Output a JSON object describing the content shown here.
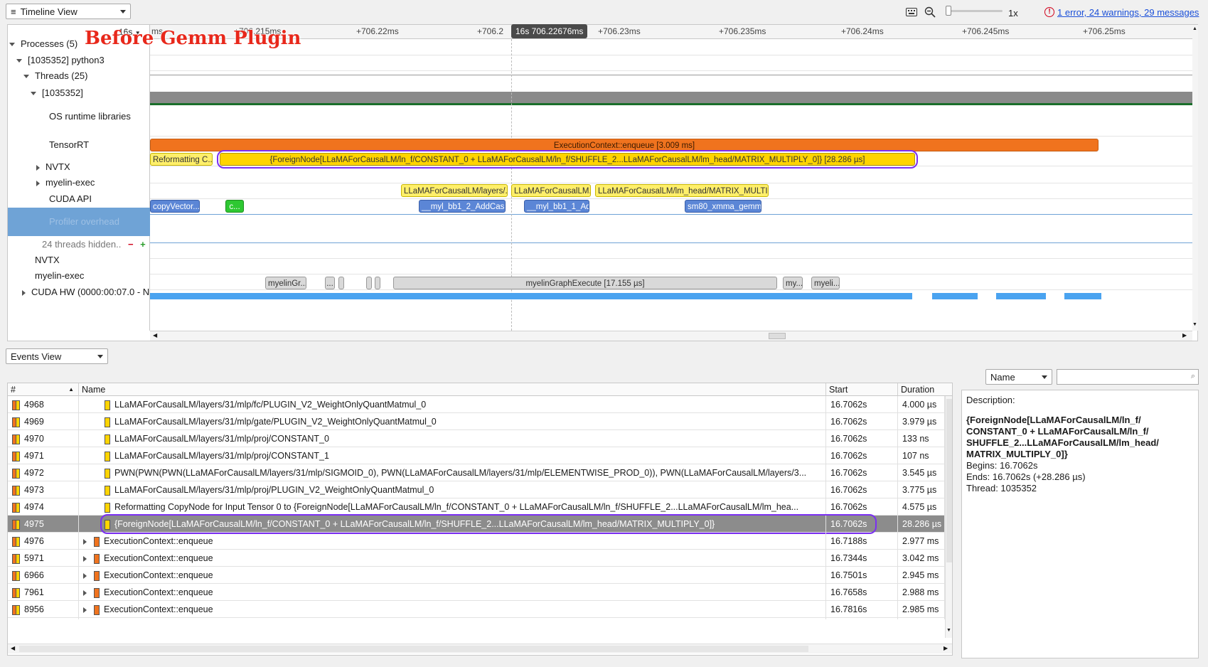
{
  "toolbar": {
    "view_label": "Timeline View",
    "zoom_label": "1x",
    "messages_link": "1 error, 24 warnings, 29 messages"
  },
  "overlay_title": "Before Gemm Plugin",
  "ruler": {
    "start_label": "16s",
    "ticks": [
      "+706.215ms",
      "+706.22ms",
      "+706.2",
      "+706.23ms",
      "+706.235ms",
      "+706.24ms",
      "+706.245ms",
      "+706.25ms"
    ],
    "left_fragment": "ms",
    "cursor_label": "16s 706.22676ms"
  },
  "tree": {
    "processes": "Processes (5)",
    "process": "[1035352] python3",
    "threads": "Threads (25)",
    "thread": "[1035352]",
    "os_runtime": "OS runtime libraries",
    "tensorrt": "TensorRT",
    "nvtx": "NVTX",
    "myelin_exec": "myelin-exec",
    "cuda_api": "CUDA API",
    "profiler_overhead": "Profiler overhead",
    "threads_hidden": "24 threads hidden..",
    "nvtx2": "NVTX",
    "myelin_exec2": "myelin-exec",
    "cuda_hw": "CUDA HW (0000:00:07.0 - N"
  },
  "tracks": {
    "enqueue": "ExecutionContext::enqueue [3.009 ms]",
    "reformatting": "Reformatting C...",
    "foreign_node": "{ForeignNode[LLaMAForCausalLM/ln_f/CONSTANT_0 + LLaMAForCausalLM/ln_f/SHUFFLE_2...LLaMAForCausalLM/lm_head/MATRIX_MULTIPLY_0]} [28.286 µs]",
    "myelin_a": "LLaMAForCausalLM/layers/...",
    "myelin_b": "LLaMAForCausalLM...",
    "myelin_c": "LLaMAForCausalLM/lm_head/MATRIX_MULTIP...",
    "cuda_copy": "copyVector...",
    "cuda_c": "c...",
    "cuda_add1": "__myl_bb1_2_AddCas...",
    "cuda_add2": "__myl_bb1_1_Ad...",
    "cuda_gemm": "sm80_xmma_gemm...",
    "myelin_gr": "myelinGr...",
    "myelin_dots": "...",
    "myelin_exec_big": "myelinGraphExecute [17.155 µs]",
    "myelin_my": "my...",
    "myelin_myeli": "myeli..."
  },
  "events_view": {
    "view_label": "Events View",
    "filter_label": "Name",
    "search_placeholder": "",
    "columns": [
      "#",
      "Name",
      "Start",
      "Duration"
    ],
    "rows": [
      {
        "id": "4968",
        "name": "LLaMAForCausalLM/layers/31/mlp/fc/PLUGIN_V2_WeightOnlyQuantMatmul_0",
        "start": "16.7062s",
        "duration": "4.000 µs",
        "marker": "y",
        "expand": false,
        "indent": 2
      },
      {
        "id": "4969",
        "name": "LLaMAForCausalLM/layers/31/mlp/gate/PLUGIN_V2_WeightOnlyQuantMatmul_0",
        "start": "16.7062s",
        "duration": "3.979 µs",
        "marker": "y",
        "expand": false,
        "indent": 2
      },
      {
        "id": "4970",
        "name": "LLaMAForCausalLM/layers/31/mlp/proj/CONSTANT_0",
        "start": "16.7062s",
        "duration": "133 ns",
        "marker": "y",
        "expand": false,
        "indent": 2
      },
      {
        "id": "4971",
        "name": "LLaMAForCausalLM/layers/31/mlp/proj/CONSTANT_1",
        "start": "16.7062s",
        "duration": "107 ns",
        "marker": "y",
        "expand": false,
        "indent": 2
      },
      {
        "id": "4972",
        "name": "PWN(PWN(PWN(LLaMAForCausalLM/layers/31/mlp/SIGMOID_0), PWN(LLaMAForCausalLM/layers/31/mlp/ELEMENTWISE_PROD_0)), PWN(LLaMAForCausalLM/layers/3...",
        "start": "16.7062s",
        "duration": "3.545 µs",
        "marker": "y",
        "expand": false,
        "indent": 2
      },
      {
        "id": "4973",
        "name": "LLaMAForCausalLM/layers/31/mlp/proj/PLUGIN_V2_WeightOnlyQuantMatmul_0",
        "start": "16.7062s",
        "duration": "3.775 µs",
        "marker": "y",
        "expand": false,
        "indent": 2
      },
      {
        "id": "4974",
        "name": "Reformatting CopyNode for Input Tensor 0 to {ForeignNode[LLaMAForCausalLM/ln_f/CONSTANT_0 + LLaMAForCausalLM/ln_f/SHUFFLE_2...LLaMAForCausalLM/lm_hea...",
        "start": "16.7062s",
        "duration": "4.575 µs",
        "marker": "y",
        "expand": false,
        "indent": 2
      },
      {
        "id": "4975",
        "name": "{ForeignNode[LLaMAForCausalLM/ln_f/CONSTANT_0 + LLaMAForCausalLM/ln_f/SHUFFLE_2...LLaMAForCausalLM/lm_head/MATRIX_MULTIPLY_0]}",
        "start": "16.7062s",
        "duration": "28.286 µs",
        "marker": "y",
        "expand": false,
        "indent": 2,
        "selected": true
      },
      {
        "id": "4976",
        "name": "ExecutionContext::enqueue",
        "start": "16.7188s",
        "duration": "2.977 ms",
        "marker": "o",
        "expand": true,
        "indent": 1
      },
      {
        "id": "5971",
        "name": "ExecutionContext::enqueue",
        "start": "16.7344s",
        "duration": "3.042 ms",
        "marker": "o",
        "expand": true,
        "indent": 1
      },
      {
        "id": "6966",
        "name": "ExecutionContext::enqueue",
        "start": "16.7501s",
        "duration": "2.945 ms",
        "marker": "o",
        "expand": true,
        "indent": 1
      },
      {
        "id": "7961",
        "name": "ExecutionContext::enqueue",
        "start": "16.7658s",
        "duration": "2.988 ms",
        "marker": "o",
        "expand": true,
        "indent": 1
      },
      {
        "id": "8956",
        "name": "ExecutionContext::enqueue",
        "start": "16.7816s",
        "duration": "2.985 ms",
        "marker": "o",
        "expand": true,
        "indent": 1
      }
    ]
  },
  "description": {
    "label": "Description:",
    "title": "{ForeignNode[LLaMAForCausalLM/ln_f/ CONSTANT_0 + LLaMAForCausalLM/ln_f/ SHUFFLE_2...LLaMAForCausalLM/lm_head/ MATRIX_MULTIPLY_0]}",
    "begins": "Begins: 16.7062s",
    "ends": "Ends: 16.7062s (+28.286 µs)",
    "thread": "Thread: 1035352"
  },
  "colors": {
    "highlight_ring": "#7b2ff2",
    "overlay_title": "#e8281b",
    "selected_row": "#8c8c8c",
    "tensorrt_orange": "#f0731e",
    "trt_yellow": "#ffd400",
    "cuda_blue": "#5b86d6",
    "link_red": "#d0021b",
    "link_blue": "#1a4fd8"
  }
}
